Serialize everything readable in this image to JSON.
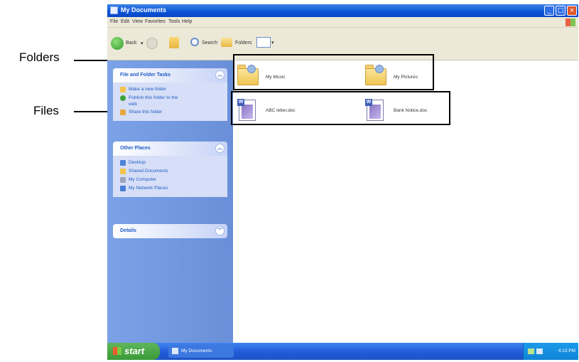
{
  "callouts": {
    "folders_label": "Folders",
    "files_label": "Files"
  },
  "window": {
    "title": "My Documents",
    "buttons": {
      "minimize": "_",
      "maximize": "□",
      "close": "×"
    }
  },
  "menu": [
    "File",
    "Edit",
    "View",
    "Favorites",
    "Tools",
    "Help"
  ],
  "toolbar": {
    "back_label": "Back",
    "search_label": "Search",
    "folders_label": "Folders"
  },
  "task_pane": {
    "file_folder_tasks": {
      "title": "File and Folder Tasks",
      "items": [
        {
          "label": "Make a new folder",
          "icon": "new-folder-icon"
        },
        {
          "label": "Publish this folder to the",
          "icon": "publish-web-icon"
        },
        {
          "label": "Share this folder",
          "icon": "share-folder-icon"
        }
      ]
    },
    "other_places": {
      "title": "Other Places",
      "items": [
        {
          "label": "Desktop",
          "icon": "desktop-icon"
        },
        {
          "label": "Shared Documents",
          "icon": "shared-documents-icon"
        },
        {
          "label": "My Computer",
          "icon": "my-computer-icon"
        },
        {
          "label": "My Network Places",
          "icon": "network-places-icon"
        }
      ]
    },
    "details": {
      "title": "Details"
    }
  },
  "content": {
    "folders": [
      {
        "name": "My Music",
        "icon": "music-folder-icon"
      },
      {
        "name": "My Pictures",
        "icon": "pictures-folder-icon"
      }
    ],
    "files": [
      {
        "name": "ABC letter.doc",
        "icon": "word-document-icon"
      },
      {
        "name": "Bank Notice.doc",
        "icon": "word-document-icon"
      }
    ]
  },
  "taskbar": {
    "start_label": "start",
    "task_button_label": "My Documents",
    "clock": "4:13 PM"
  },
  "colors": {
    "titlebar": "#0a52d6",
    "taskpane": "#7ba2e7",
    "taskbar": "#245edb",
    "start": "#3a9a38"
  }
}
